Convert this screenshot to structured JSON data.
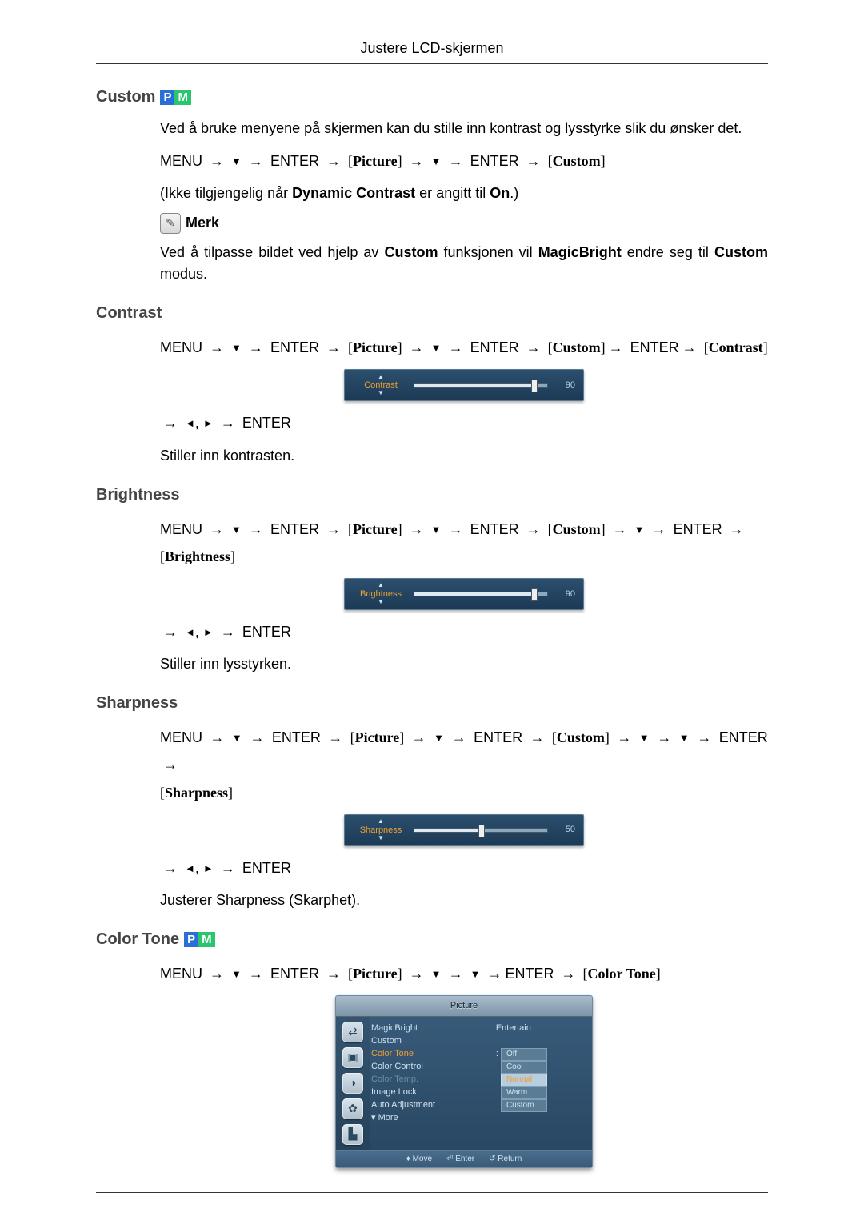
{
  "header": {
    "title": "Justere LCD-skjermen"
  },
  "sections": {
    "custom": {
      "title": "Custom",
      "intro": "Ved å bruke menyene på skjermen kan du stille inn kontrast og lysstyrke slik du ønsker det.",
      "nav": {
        "menu": "MENU",
        "enter": "ENTER",
        "picture": "Picture",
        "custom": "Custom"
      },
      "unavail_pre": "(Ikke tilgjengelig når",
      "unavail_b1": "Dynamic Contrast",
      "unavail_mid": "er angitt til",
      "unavail_b2": "On",
      "unavail_post": ".)",
      "note_label": "Merk",
      "note_pre": "Ved å tilpasse bildet ved hjelp av",
      "note_b1": "Custom",
      "note_mid1": "funksjonen vil",
      "note_b2": "MagicBright",
      "note_mid2": "endre seg til",
      "note_b3": "Cus­tom",
      "note_post": "modus."
    },
    "contrast": {
      "title": "Contrast",
      "nav": {
        "menu": "MENU",
        "enter": "ENTER",
        "picture": "Picture",
        "custom": "Custom",
        "contrast": "Contrast"
      },
      "slider": {
        "label": "Contrast",
        "value": 90,
        "percent": 90
      },
      "enter": "ENTER",
      "desc": "Stiller inn kontrasten."
    },
    "brightness": {
      "title": "Brightness",
      "nav": {
        "menu": "MENU",
        "enter": "ENTER",
        "picture": "Picture",
        "custom": "Custom",
        "brightness": "Brightness"
      },
      "slider": {
        "label": "Brightness",
        "value": 90,
        "percent": 90
      },
      "enter": "ENTER",
      "desc": "Stiller inn lysstyrken."
    },
    "sharpness": {
      "title": "Sharpness",
      "nav": {
        "menu": "MENU",
        "enter": "ENTER",
        "picture": "Picture",
        "custom": "Custom",
        "sharpness": "Sharpness"
      },
      "slider": {
        "label": "Sharpness",
        "value": 50,
        "percent": 50
      },
      "enter": "ENTER",
      "desc": "Justerer Sharpness (Skarphet)."
    },
    "colortone": {
      "title": "Color Tone",
      "nav": {
        "menu": "MENU",
        "enter": "ENTER",
        "picture": "Picture",
        "colortone": "Color Tone"
      },
      "menu": {
        "title": "Picture",
        "items": {
          "magicbright": "MagicBright",
          "custom": "Custom",
          "colortone": "Color Tone",
          "colorcontrol": "Color Control",
          "colortemp": "Color Temp.",
          "imagelock": "Image Lock",
          "autoadjust": "Auto Adjustment",
          "more": "More"
        },
        "val_entertain": "Entertain",
        "colon": ":",
        "options": {
          "off": "Off",
          "cool": "Cool",
          "normal": "Normal",
          "warm": "Warm",
          "custom": "Custom"
        },
        "footer": {
          "move": "Move",
          "enter": "Enter",
          "return": "Return"
        }
      }
    }
  },
  "glyphs": {
    "arrow_right": "→",
    "tri_down": "▼",
    "tri_left": "◄",
    "tri_right": "►",
    "comma": ","
  }
}
